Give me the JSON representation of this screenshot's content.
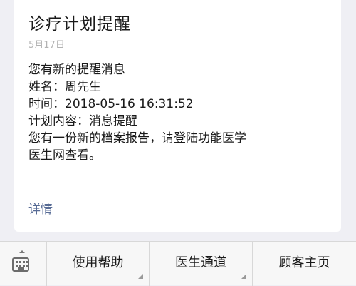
{
  "message": {
    "title": "诊疗计划提醒",
    "date": "5月17日",
    "lines": [
      "您有新的提醒消息",
      "姓名：周先生",
      "时间：2018-05-16 16:31:52",
      "计划内容：消息提醒",
      "您有一份新的档案报告，请登陆功能医学",
      "医生网查看。"
    ],
    "detail_label": "详情"
  },
  "bottom_menu": {
    "keyboard_icon": "keyboard-icon",
    "items": [
      {
        "label": "使用帮助"
      },
      {
        "label": "医生通道"
      },
      {
        "label": "顾客主页"
      }
    ]
  }
}
